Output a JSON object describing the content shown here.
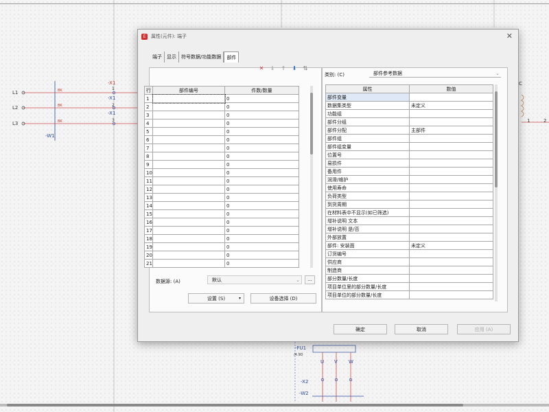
{
  "schematic": {
    "left_labels": [
      "L1",
      "L2",
      "L3"
    ],
    "wire_marks": [
      "BK",
      "BK",
      "BK"
    ],
    "x1_labels": [
      "-X1",
      "1",
      "-X1",
      "2",
      "-X1",
      "3"
    ],
    "w1_label": "-W1",
    "fu1_label": "-FU1",
    "fu1_sub": "/4.9D",
    "uvw": [
      "U",
      "V",
      "W"
    ],
    "x2_label": "-X2",
    "w2_label": "-W2",
    "right_nums": [
      "1",
      "2",
      "0"
    ],
    "right_c": "C"
  },
  "dialog": {
    "title": "属性(元件): 端子",
    "tabs": [
      "端子",
      "显示",
      "符号数据/功能数据",
      "部件"
    ],
    "active_tab": "部件",
    "parts_table": {
      "headers": [
        "行",
        "部件编号",
        "件数/数量"
      ],
      "rows": [
        [
          "1",
          "",
          "0"
        ],
        [
          "2",
          "",
          "0"
        ],
        [
          "3",
          "",
          "0"
        ],
        [
          "4",
          "",
          "0"
        ],
        [
          "5",
          "",
          "0"
        ],
        [
          "6",
          "",
          "0"
        ],
        [
          "7",
          "",
          "0"
        ],
        [
          "8",
          "",
          "0"
        ],
        [
          "9",
          "",
          "0"
        ],
        [
          "10",
          "",
          "0"
        ],
        [
          "11",
          "",
          "0"
        ],
        [
          "12",
          "",
          "0"
        ],
        [
          "13",
          "",
          "0"
        ],
        [
          "14",
          "",
          "0"
        ],
        [
          "15",
          "",
          "0"
        ],
        [
          "16",
          "",
          "0"
        ],
        [
          "17",
          "",
          "0"
        ],
        [
          "18",
          "",
          "0"
        ],
        [
          "19",
          "",
          "0"
        ],
        [
          "20",
          "",
          "0"
        ],
        [
          "21",
          "",
          "0"
        ]
      ]
    },
    "toolbar_icons": [
      "delete-icon",
      "move-down-icon",
      "move-up-icon",
      "insert-icon",
      "sort-icon"
    ],
    "category_label": "类别: (C)",
    "category_value": "部件参考数据",
    "prop_table": {
      "headers": [
        "属性",
        "数值"
      ],
      "rows": [
        [
          "部件变量",
          ""
        ],
        [
          "数据集类型",
          "未定义"
        ],
        [
          "功能组",
          ""
        ],
        [
          "部件分组",
          ""
        ],
        [
          "部件分配",
          "主部件"
        ],
        [
          "部件组",
          ""
        ],
        [
          "部件组变量",
          ""
        ],
        [
          "位置号",
          ""
        ],
        [
          "易损件",
          ""
        ],
        [
          "备用件",
          ""
        ],
        [
          "润滑/维护",
          ""
        ],
        [
          "使用寿命",
          ""
        ],
        [
          "负荷类型",
          ""
        ],
        [
          "到货周期",
          ""
        ],
        [
          "在材料表中不显示(如已筛选)",
          ""
        ],
        [
          "增补说明 文本",
          ""
        ],
        [
          "增补说明 是/否",
          ""
        ],
        [
          "外部放置",
          ""
        ],
        [
          "部件: 安装面",
          "未定义"
        ],
        [
          "订货编号",
          ""
        ],
        [
          "供应商",
          ""
        ],
        [
          "制造商",
          ""
        ],
        [
          "部分数量/长度",
          ""
        ],
        [
          "项目单位里的部分数量/长度",
          ""
        ],
        [
          "项目单位的部分数量/长度",
          ""
        ]
      ]
    },
    "datasource_label": "数据源: (A)",
    "datasource_value": "默认",
    "more_button": "...",
    "setup_button": "设置 (S)",
    "device_select_button": "设备选择 (D)",
    "ok_button": "确定",
    "cancel_button": "取消",
    "apply_button": "应用 (A)"
  }
}
